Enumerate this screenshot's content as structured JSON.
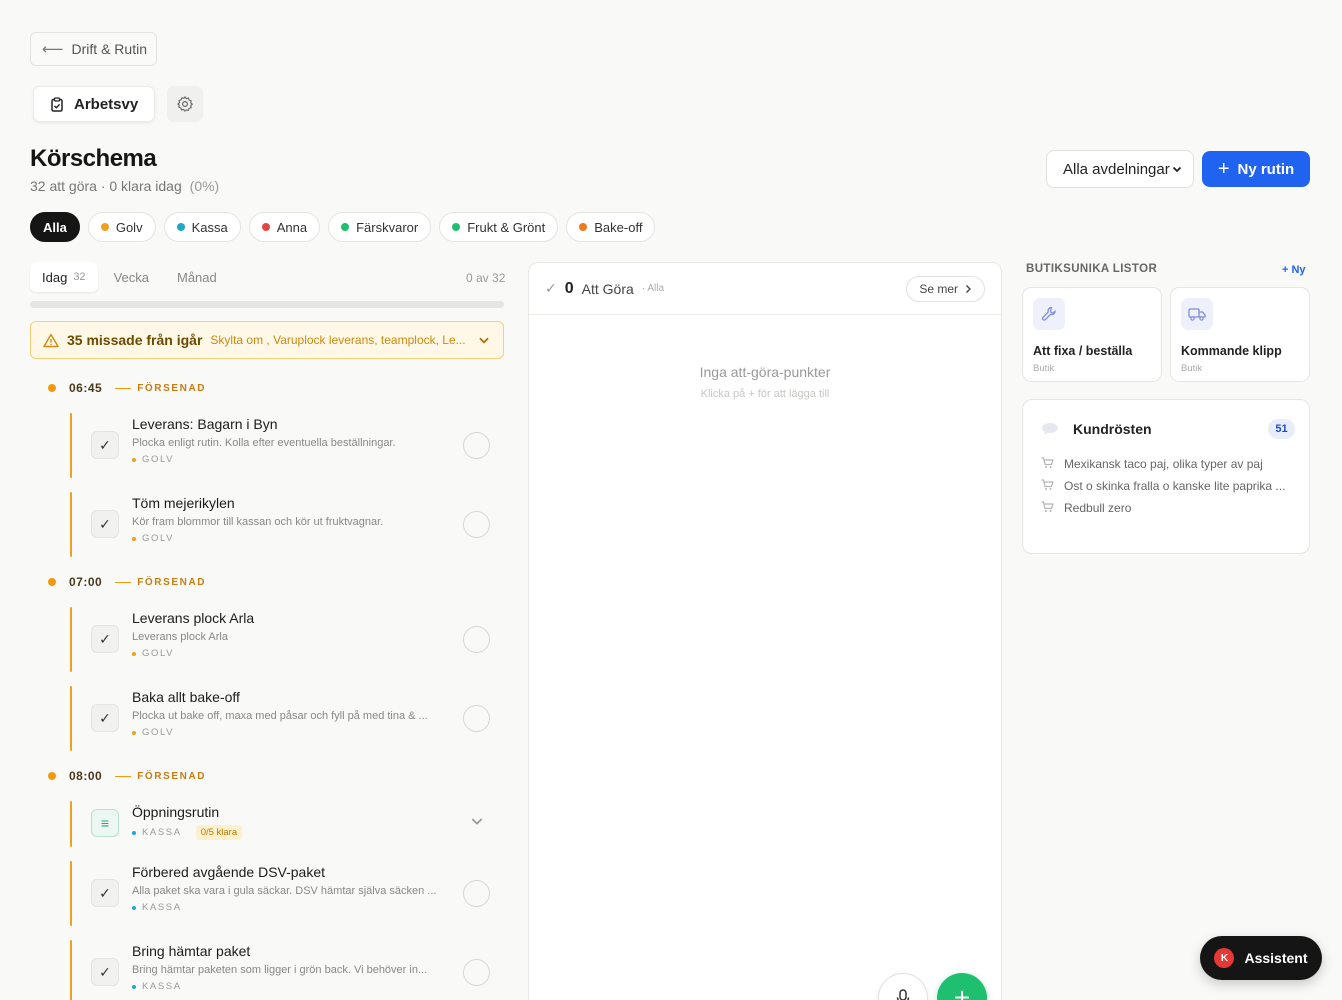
{
  "nav": {
    "back_label": "Drift & Rutin"
  },
  "view": {
    "label": "Arbetsvy"
  },
  "header": {
    "title": "Körschema",
    "subtitle": "32 att göra · 0 klara idag",
    "percent": "(0%)",
    "dept_select": "Alla avdelningar",
    "new_button": "Ny rutin"
  },
  "filters": [
    {
      "label": "Alla",
      "color": "",
      "active": true
    },
    {
      "label": "Golv",
      "color": "#f0a020"
    },
    {
      "label": "Kassa",
      "color": "#1fa8c9"
    },
    {
      "label": "Anna",
      "color": "#e04848"
    },
    {
      "label": "Färskvaror",
      "color": "#1fbf70"
    },
    {
      "label": "Frukt & Grönt",
      "color": "#1fbf70"
    },
    {
      "label": "Bake-off",
      "color": "#f07a20"
    }
  ],
  "tabs": [
    {
      "label": "Idag",
      "count": "32",
      "active": true
    },
    {
      "label": "Vecka",
      "count": ""
    },
    {
      "label": "Månad",
      "count": ""
    }
  ],
  "progress": {
    "text": "0 av 32",
    "fraction": 0
  },
  "missed": {
    "title": "35 missade från igår",
    "description": "Skylta om , Varuplock leverans, teamplock, Le..."
  },
  "timeline": [
    {
      "time": "06:45",
      "status": "FÖRSENAD",
      "tasks": [
        {
          "title": "Leverans: Bagarn i Byn",
          "desc": "Plocka enligt rutin. Kolla efter eventuella beställningar.",
          "tag": "GOLV",
          "tag_color": "#f0a020",
          "kind": "check"
        },
        {
          "title": "Töm mejerikylen",
          "desc": "Kör fram blommor till kassan och kör ut fruktvagnar.",
          "tag": "GOLV",
          "tag_color": "#f0a020",
          "kind": "check"
        }
      ]
    },
    {
      "time": "07:00",
      "status": "FÖRSENAD",
      "tasks": [
        {
          "title": "Leverans plock Arla",
          "desc": "Leverans plock Arla",
          "tag": "GOLV",
          "tag_color": "#f0a020",
          "kind": "check"
        },
        {
          "title": "Baka allt bake-off",
          "desc": "Plocka ut bake off, maxa med påsar och fyll på med tina & ...",
          "tag": "GOLV",
          "tag_color": "#f0a020",
          "kind": "check"
        }
      ]
    },
    {
      "time": "08:00",
      "status": "FÖRSENAD",
      "tasks": [
        {
          "title": "Öppningsrutin",
          "desc": "",
          "tag": "KASSA",
          "tag_color": "#1fa8c9",
          "badge": "0/5 klara",
          "kind": "list"
        },
        {
          "title": "Förbered avgående DSV-paket",
          "desc": "Alla paket ska vara i gula säckar. DSV hämtar själva säcken ...",
          "tag": "KASSA",
          "tag_color": "#1fa8c9",
          "kind": "check"
        },
        {
          "title": "Bring hämtar paket",
          "desc": "Bring hämtar paketen som ligger i grön back. Vi behöver in...",
          "tag": "KASSA",
          "tag_color": "#1fa8c9",
          "kind": "check"
        }
      ]
    }
  ],
  "todo": {
    "count": "0",
    "label": "Att Göra",
    "scope": "· Alla",
    "more": "Se mer",
    "empty_title": "Inga att-göra-punkter",
    "empty_sub": "Klicka på + för att lägga till"
  },
  "lists": {
    "heading": "BUTIKSUNIKA LISTOR",
    "new_label": "+ Ny",
    "cards": [
      {
        "name": "Att fixa / beställa",
        "sub": "Butik",
        "icon": "wrench-icon"
      },
      {
        "name": "Kommande klipp",
        "sub": "Butik",
        "icon": "truck-icon"
      }
    ]
  },
  "voice": {
    "title": "Kundrösten",
    "count": "51",
    "items": [
      "Mexikansk taco paj, olika typer av paj",
      "Ost o skinka fralla o kanske lite paprika ...",
      "Redbull zero"
    ]
  },
  "assistant": {
    "label": "Assistent",
    "avatar": "K"
  },
  "colors": {
    "accent": "#1f63f0",
    "success": "#1fbf70",
    "warning": "#f0a020"
  }
}
